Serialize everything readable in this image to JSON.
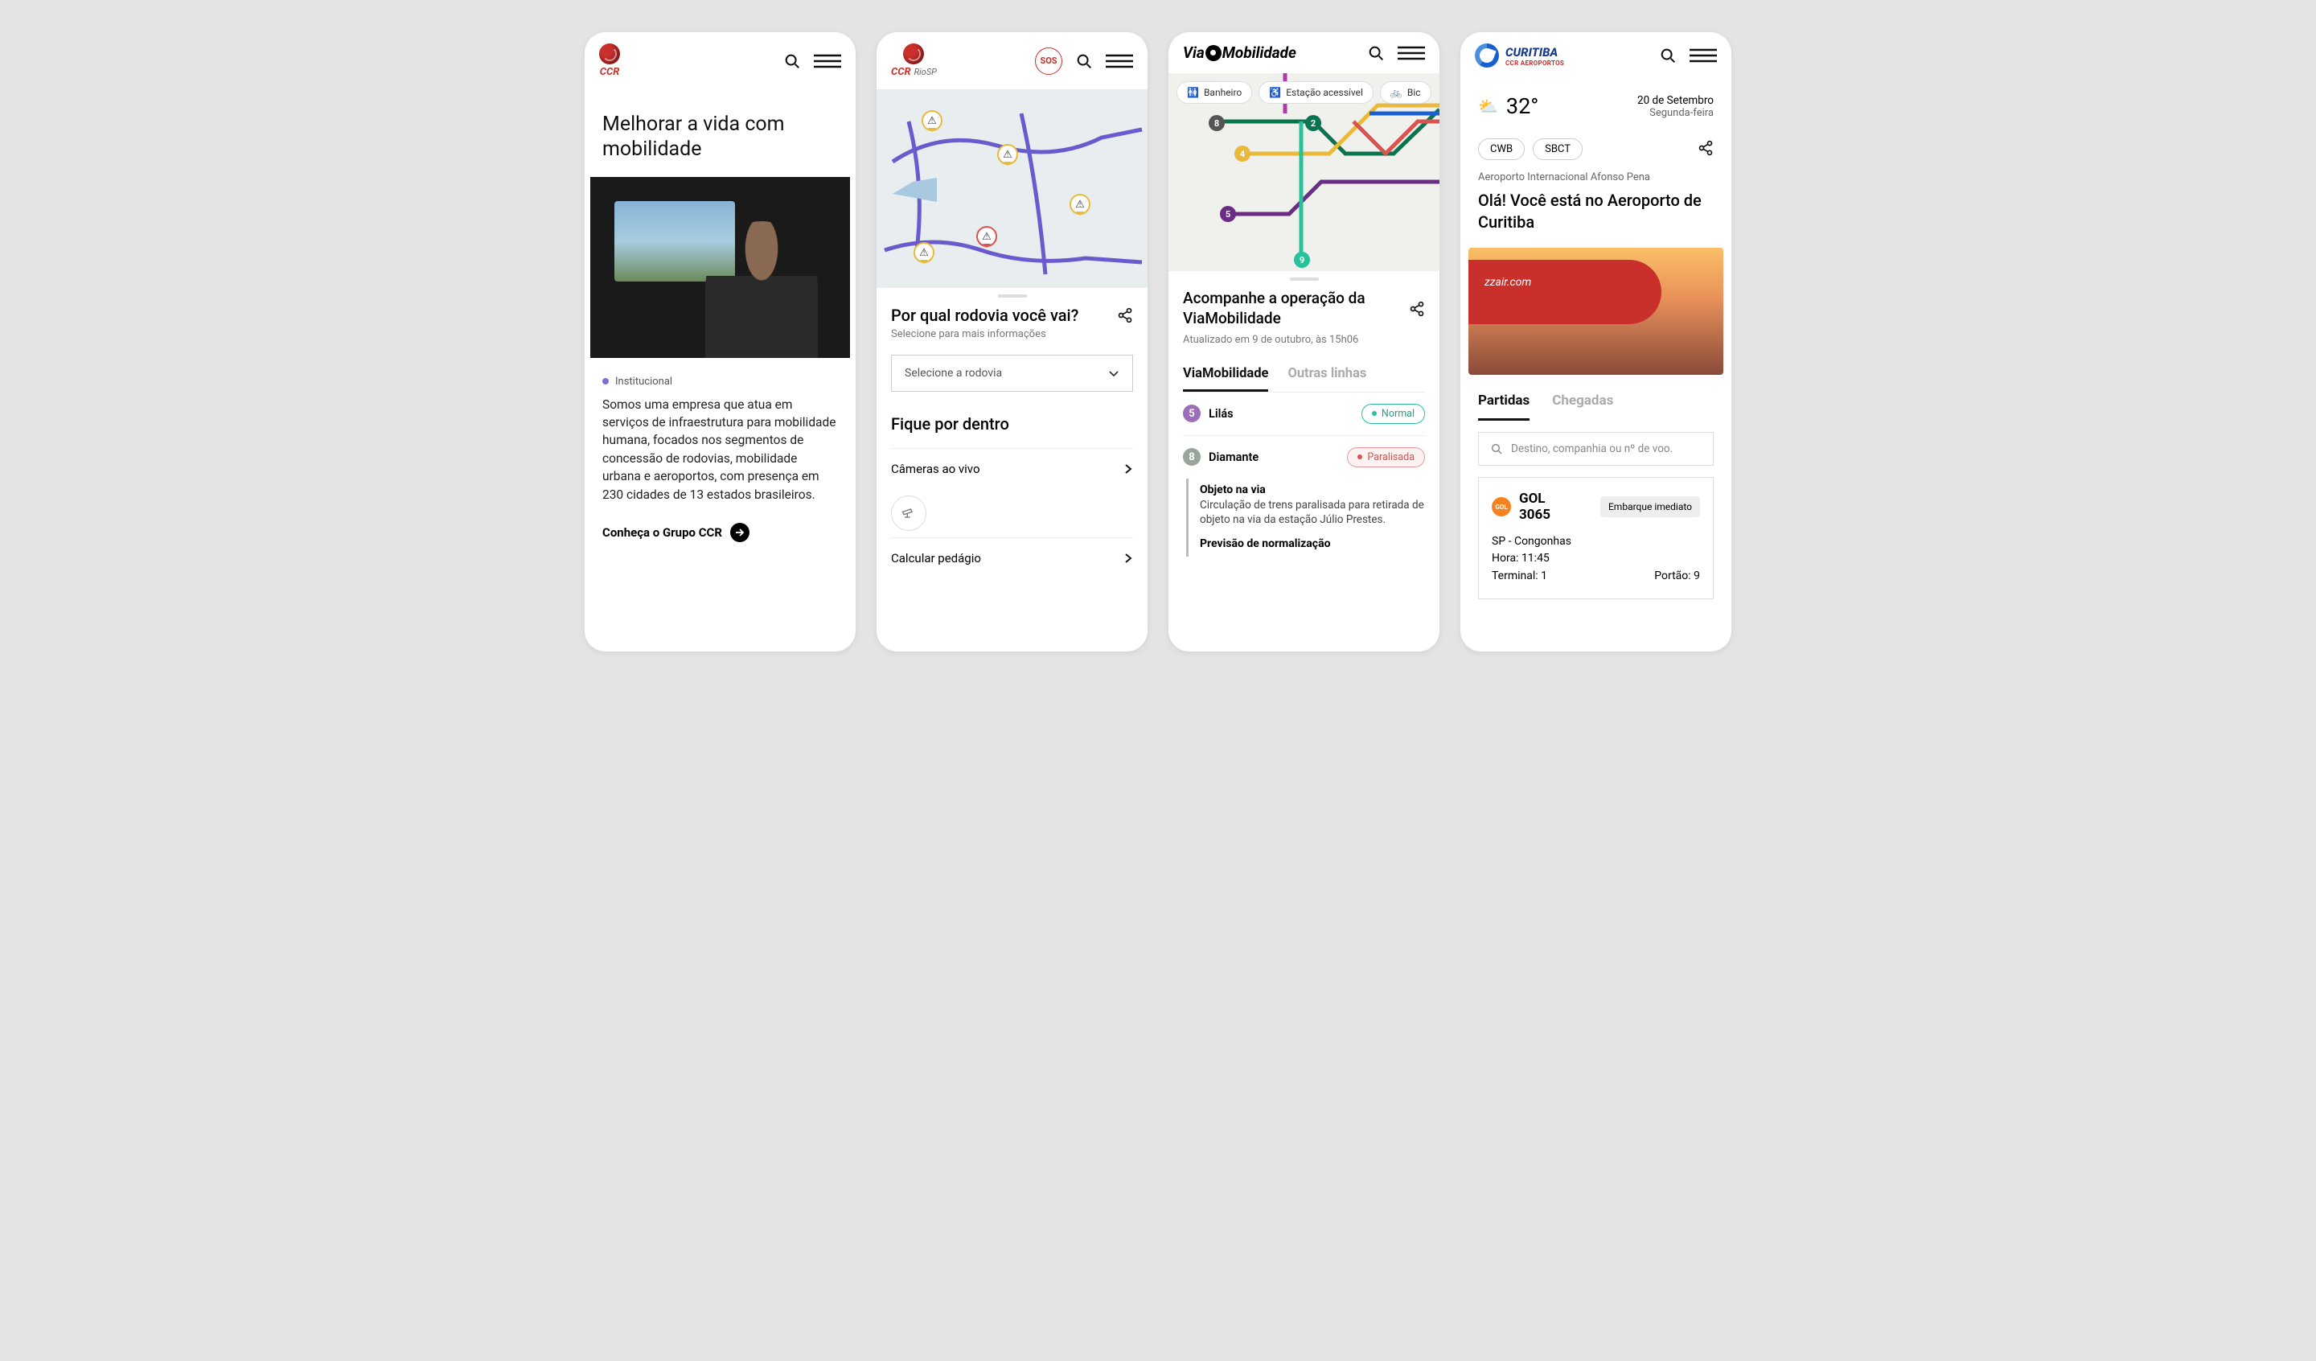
{
  "screen1": {
    "logo_text": "CCR",
    "title": "Melhorar a vida com mobilidade",
    "tag": "Institucional",
    "description": "Somos uma empresa que atua em serviços de infraestrutura para mobilidade humana, focados nos segmentos de concessão de rodovias, mobilidade urbana e aeroportos, com presença em 230 cidades de 13 estados brasileiros.",
    "cta": "Conheça o Grupo CCR"
  },
  "screen2": {
    "logo_text": "CCR",
    "logo_sub": "RioSP",
    "sos": "SOS",
    "panel_title": "Por qual rodovia você vai?",
    "panel_sub": "Selecione para mais informações",
    "select_placeholder": "Selecione a rodovia",
    "section_title": "Fique por dentro",
    "items": [
      "Câmeras ao vivo",
      "Calcular pedágio"
    ]
  },
  "screen3": {
    "logo_pre": "Via",
    "logo_post": "Mobilidade",
    "chips": [
      "Banheiro",
      "Estação acessível",
      "Bic"
    ],
    "panel_title": "Acompanhe a operação da ViaMobilidade",
    "updated": "Atualizado em 9 de outubro, às 15h06",
    "tabs": [
      "ViaMobilidade",
      "Outras linhas"
    ],
    "lines": [
      {
        "num": "5",
        "name": "Lilás",
        "color": "#9b6fb8",
        "status": "Normal",
        "status_type": "green"
      },
      {
        "num": "8",
        "name": "Diamante",
        "color": "#9aa59a",
        "status": "Paralisada",
        "status_type": "red"
      }
    ],
    "incident": {
      "title1": "Objeto na via",
      "desc": "Circulação de trens paralisada para retirada de objeto na via da estação Júlio Prestes.",
      "title2": "Previsão de normalização"
    }
  },
  "screen4": {
    "logo_title": "CURITIBA",
    "logo_sub": "CCR AEROPORTOS",
    "temp": "32°",
    "date": "20 de Setembro",
    "day": "Segunda-feira",
    "codes": [
      "CWB",
      "SBCT"
    ],
    "airport_name": "Aeroporto Internacional Afonso Pena",
    "greeting": "Olá! Você está no Aeroporto de Curitiba",
    "plane_livery": "zzair.com",
    "tabs": [
      "Partidas",
      "Chegadas"
    ],
    "search_placeholder": "Destino, companhia ou nº de voo.",
    "flight": {
      "airline_code": "GOL",
      "airline": "GOL",
      "number": "3065",
      "status": "Embarque imediato",
      "destination": "SP - Congonhas",
      "time_label": "Hora:",
      "time": "11:45",
      "terminal_label": "Terminal:",
      "terminal": "1",
      "gate_label": "Portão:",
      "gate": "9"
    }
  }
}
